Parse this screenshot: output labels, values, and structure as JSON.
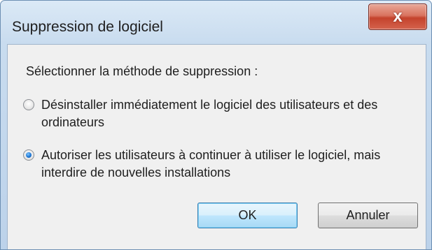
{
  "window": {
    "title": "Suppression de logiciel",
    "close_glyph": "x"
  },
  "dialog": {
    "heading": "Sélectionner la méthode de suppression :",
    "options": [
      {
        "label": "Désinstaller immédiatement le logiciel des utilisateurs et des ordinateurs",
        "selected": false
      },
      {
        "label": "Autoriser les utilisateurs à continuer à utiliser le logiciel, mais interdire de nouvelles installations",
        "selected": true
      }
    ],
    "ok_label": "OK",
    "cancel_label": "Annuler"
  },
  "colors": {
    "accent": "#1f77d4",
    "close_button": "#c4432c",
    "client_bg": "#f0f0f0"
  }
}
